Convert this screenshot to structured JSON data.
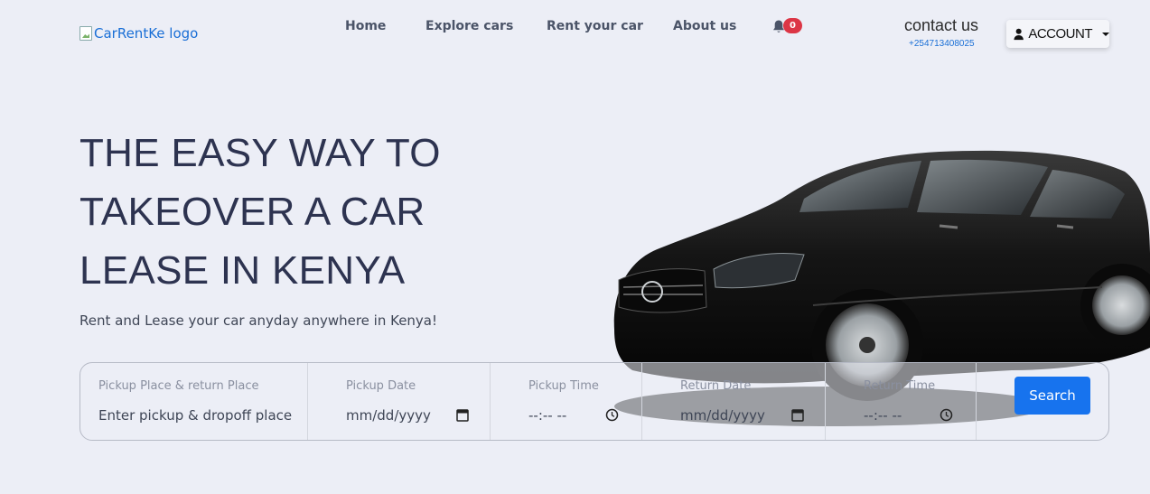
{
  "header": {
    "logo_alt": "CarRentKe logo",
    "nav": [
      {
        "label": "Home"
      },
      {
        "label": "Explore cars"
      },
      {
        "label": "Rent your car"
      },
      {
        "label": "About us"
      }
    ],
    "notification_count": "0",
    "contact_title": "contact us",
    "contact_phone": "+254713408025",
    "account_label": "ACCOUNT"
  },
  "hero": {
    "title": "THE EASY WAY TO TAKEOVER A CAR LEASE IN KENYA",
    "subtitle": "Rent and Lease your car anyday anywhere in Kenya!"
  },
  "search": {
    "place_label": "Pickup Place & return Place",
    "place_placeholder": "Enter pickup & dropoff place",
    "pickup_date_label": "Pickup Date",
    "pickup_date_value": "mm/dd/yyyy",
    "pickup_time_label": "Pickup Time",
    "pickup_time_value": "--:-- --",
    "return_date_label": "Return Date",
    "return_date_value": "mm/dd/yyyy",
    "return_time_label": "Return Time",
    "return_time_value": "--:-- --",
    "button_label": "Search"
  },
  "colors": {
    "background": "#eceef6",
    "primary": "#1773ee",
    "badge": "#dc3545",
    "link": "#1a6fd6"
  }
}
